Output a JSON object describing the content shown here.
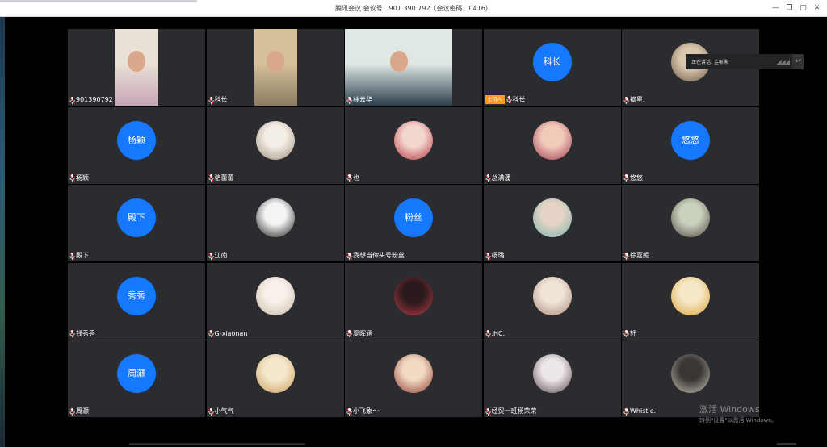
{
  "window": {
    "title": "腾讯会议 会议号：901 390 792（会议密码：0416）",
    "controls": {
      "minimize": "—",
      "restore": "❐",
      "maximize": "□",
      "close": "✕"
    }
  },
  "speaking": {
    "label": "正在讲话: 金晰朱"
  },
  "participants": [
    {
      "name": "901390792",
      "kind": "video",
      "tone": [
        "#e9e1d6",
        "#c7a4b6"
      ]
    },
    {
      "name": "科长",
      "kind": "video",
      "tone": [
        "#d5c09b",
        "#8c7c63"
      ]
    },
    {
      "name": "林云华",
      "kind": "video",
      "tone": [
        "#dfe8e6",
        "#2c3f4e"
      ]
    },
    {
      "name": "科长",
      "kind": "initials",
      "initials": "科长",
      "host": "主持人"
    },
    {
      "name": "摘星.",
      "kind": "photo",
      "tone": [
        "#d9c7ad",
        "#6f5a49"
      ]
    },
    {
      "name": "杨颖",
      "kind": "initials",
      "initials": "杨颖"
    },
    {
      "name": "骆蕾蕾",
      "kind": "photo",
      "tone": [
        "#f3eee6",
        "#9e8b78"
      ]
    },
    {
      "name": "也",
      "kind": "photo",
      "tone": [
        "#f2d7cf",
        "#b5303a"
      ]
    },
    {
      "name": "总满潘",
      "kind": "photo",
      "tone": [
        "#f1cbb9",
        "#a03a56"
      ]
    },
    {
      "name": "悠悠",
      "kind": "initials",
      "initials": "悠悠"
    },
    {
      "name": "殿下",
      "kind": "initials",
      "initials": "殿下"
    },
    {
      "name": "江南",
      "kind": "photo",
      "tone": [
        "#f4f4f4",
        "#1c1c1c"
      ]
    },
    {
      "name": "我想当你头号粉丝",
      "kind": "initials",
      "initials": "粉丝"
    },
    {
      "name": "杨璐",
      "kind": "photo",
      "tone": [
        "#e6d3c6",
        "#7ab3a9"
      ]
    },
    {
      "name": "徐嘉妮",
      "kind": "photo",
      "tone": [
        "#c9d2bf",
        "#54463e"
      ]
    },
    {
      "name": "钱秀秀",
      "kind": "initials",
      "initials": "秀秀"
    },
    {
      "name": "G-xiaonan",
      "kind": "photo",
      "tone": [
        "#f7f1ea",
        "#c7b7a4"
      ]
    },
    {
      "name": "夏晖涵",
      "kind": "photo",
      "tone": [
        "#2b1a1d",
        "#b83c47"
      ]
    },
    {
      "name": ".HC.",
      "kind": "photo",
      "tone": [
        "#f0e4d9",
        "#a98877"
      ]
    },
    {
      "name": "轩",
      "kind": "photo",
      "tone": [
        "#f6e7c6",
        "#d8a23b"
      ]
    },
    {
      "name": "周灏",
      "kind": "initials",
      "initials": "周灏"
    },
    {
      "name": "小气气",
      "kind": "photo",
      "tone": [
        "#f5e8cc",
        "#c99d61"
      ]
    },
    {
      "name": "小飞象～",
      "kind": "photo",
      "tone": [
        "#f2d9c4",
        "#8b3b2b"
      ]
    },
    {
      "name": "经贸一班杨荣荣",
      "kind": "photo",
      "tone": [
        "#ece6e6",
        "#5b4b52"
      ]
    },
    {
      "name": "Whistle.",
      "kind": "photo",
      "tone": [
        "#3a3634",
        "#c8c0b4"
      ]
    }
  ],
  "watermark": {
    "line1": "激活 Windows",
    "line2": "转到\"设置\"以激活 Windows。"
  },
  "colors": {
    "tile_bg": "#2b2c2f",
    "avatar_blue": "#1677ff",
    "host_badge": "#f59a23"
  }
}
